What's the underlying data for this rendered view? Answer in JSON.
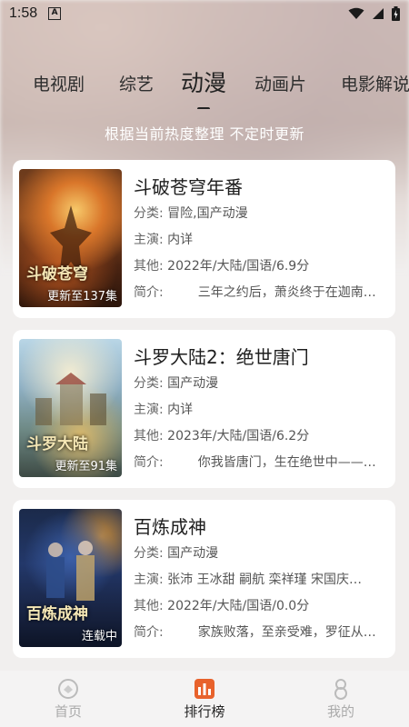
{
  "status_bar": {
    "time": "1:58",
    "a_badge": "A"
  },
  "tabs": [
    {
      "label": "电视剧",
      "active": false
    },
    {
      "label": "综艺",
      "active": false
    },
    {
      "label": "动漫",
      "active": true
    },
    {
      "label": "动画片",
      "active": false
    },
    {
      "label": "电影解说",
      "active": false
    }
  ],
  "subtitle": "根据当前热度整理 不定时更新",
  "labels": {
    "category": "分类:",
    "cast": "主演:",
    "other": "其他:",
    "intro": "简介:"
  },
  "items": [
    {
      "title": "斗破苍穹年番",
      "category": "冒险,国产动漫",
      "cast": "内详",
      "other": "2022年/大陆/国语/6.9分",
      "intro": "三年之约后，萧炎终于在迦南…",
      "badge": "更新至137集",
      "logo": "斗破苍穹"
    },
    {
      "title": "斗罗大陆2：绝世唐门",
      "category": "国产动漫",
      "cast": "内详",
      "other": "2023年/大陆/国语/6.2分",
      "intro": "你我皆唐门，生在绝世中——…",
      "badge": "更新至91集",
      "logo": "斗罗大陆"
    },
    {
      "title": "百炼成神",
      "category": "国产动漫",
      "cast": "张沛 王冰甜 嗣航 栾祥瑾 宋国庆…",
      "other": "2022年/大陆/国语/0.0分",
      "intro": "家族败落，至亲受难，罗征从…",
      "badge": "连载中",
      "logo": "百炼成神"
    }
  ],
  "bottom_nav": [
    {
      "label": "首页",
      "icon": "home-icon",
      "active": false
    },
    {
      "label": "排行榜",
      "icon": "ranking-icon",
      "active": true
    },
    {
      "label": "我的",
      "icon": "profile-icon",
      "active": false
    }
  ],
  "colors": {
    "accent_orange": "#e8622c",
    "card_bg": "#ffffff",
    "page_bg": "#f1efee"
  }
}
